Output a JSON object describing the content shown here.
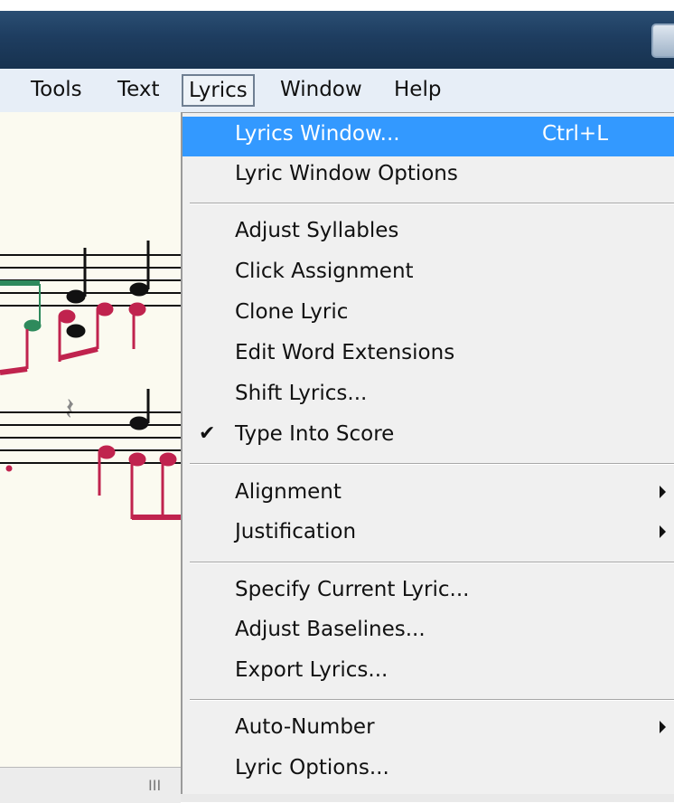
{
  "top_strip_text": "                                                                 ",
  "menubar": {
    "items": [
      {
        "label": "Tools",
        "active": false
      },
      {
        "label": "Text",
        "active": false
      },
      {
        "label": "Lyrics",
        "active": true
      },
      {
        "label": "Window",
        "active": false
      },
      {
        "label": "Help",
        "active": false
      }
    ]
  },
  "dropdown": {
    "items": [
      {
        "label": "Lyrics Window...",
        "shortcut": "Ctrl+L",
        "highlight": true
      },
      {
        "label": "Lyric Window Options"
      },
      {
        "separator": true
      },
      {
        "label": "Adjust Syllables"
      },
      {
        "label": "Click Assignment"
      },
      {
        "label": "Clone Lyric"
      },
      {
        "label": "Edit Word Extensions"
      },
      {
        "label": "Shift Lyrics..."
      },
      {
        "label": "Type Into Score",
        "checked": true
      },
      {
        "separator": true
      },
      {
        "label": "Alignment",
        "submenu": true
      },
      {
        "label": "Justification",
        "submenu": true
      },
      {
        "separator": true
      },
      {
        "label": "Specify Current Lyric..."
      },
      {
        "label": "Adjust Baselines..."
      },
      {
        "label": "Export Lyrics..."
      },
      {
        "separator": true
      },
      {
        "label": "Auto-Number",
        "submenu": true
      },
      {
        "label": "Lyric Options..."
      }
    ]
  },
  "scrollbar_grip": "III",
  "colors": {
    "titlebar": "#1e3d60",
    "highlight": "#3399ff",
    "note_red": "#c0234e",
    "note_green": "#2e8a5c"
  }
}
